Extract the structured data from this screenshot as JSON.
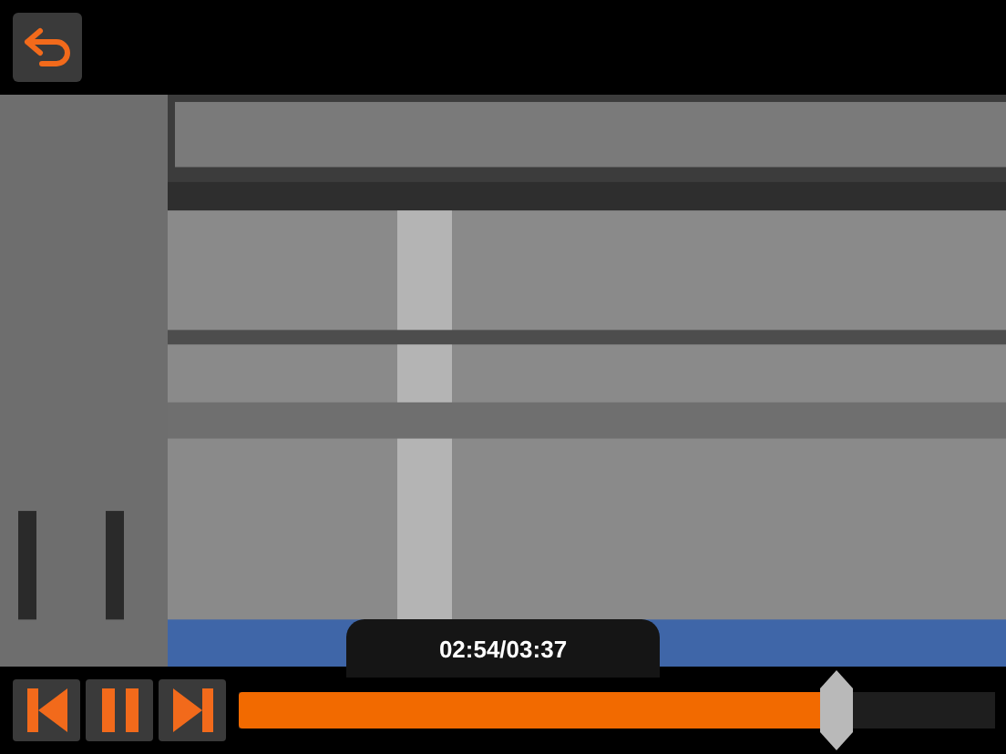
{
  "player": {
    "time": "02:54/03:37",
    "level": 0.79,
    "playing": true
  }
}
